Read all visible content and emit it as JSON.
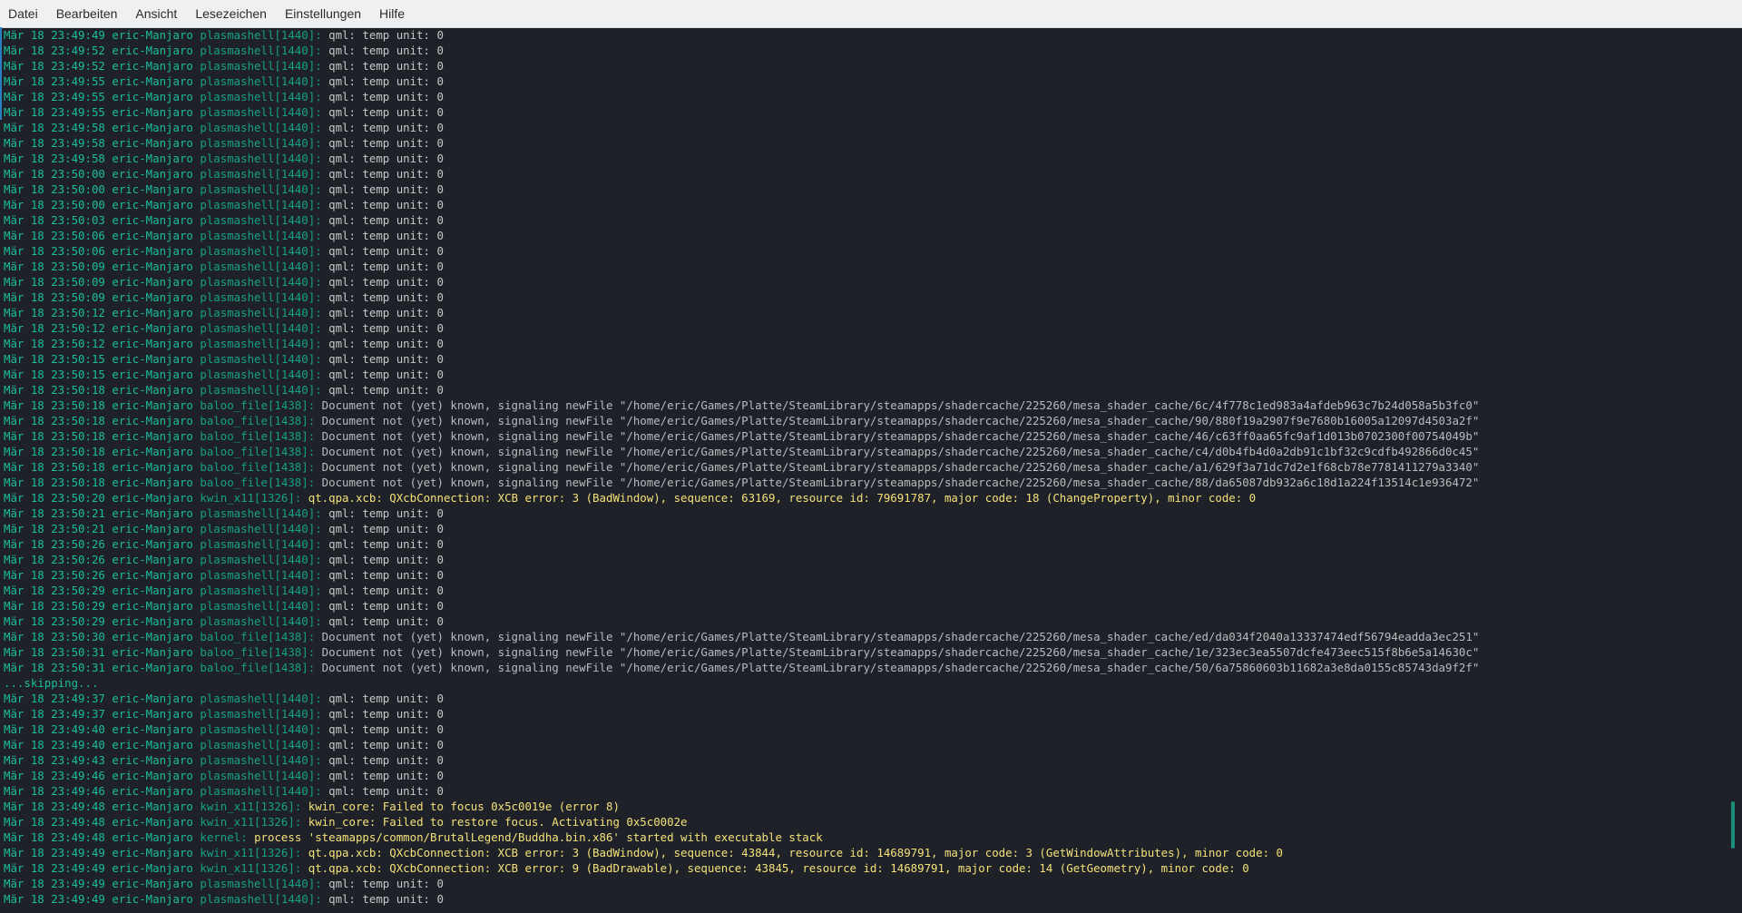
{
  "menubar": {
    "items": [
      "Datei",
      "Bearbeiten",
      "Ansicht",
      "Lesezeichen",
      "Einstellungen",
      "Hilfe"
    ]
  },
  "colors": {
    "background": "#1e2228",
    "timestamp": "#1abc9c",
    "warning": "#f4e07a",
    "message": "#c6c7c6"
  },
  "log": {
    "lines": [
      {
        "ts": "Mär 18 23:49:49",
        "host": "eric-Manjaro",
        "proc": "plasmashell[1440]:",
        "msg": "qml: temp unit: 0",
        "level": "normal",
        "sel": true
      },
      {
        "ts": "Mär 18 23:49:52",
        "host": "eric-Manjaro",
        "proc": "plasmashell[1440]:",
        "msg": "qml: temp unit: 0",
        "level": "normal",
        "sel": true
      },
      {
        "ts": "Mär 18 23:49:52",
        "host": "eric-Manjaro",
        "proc": "plasmashell[1440]:",
        "msg": "qml: temp unit: 0",
        "level": "normal",
        "sel": true
      },
      {
        "ts": "Mär 18 23:49:55",
        "host": "eric-Manjaro",
        "proc": "plasmashell[1440]:",
        "msg": "qml: temp unit: 0",
        "level": "normal",
        "sel": true
      },
      {
        "ts": "Mär 18 23:49:55",
        "host": "eric-Manjaro",
        "proc": "plasmashell[1440]:",
        "msg": "qml: temp unit: 0",
        "level": "normal",
        "sel": true
      },
      {
        "ts": "Mär 18 23:49:55",
        "host": "eric-Manjaro",
        "proc": "plasmashell[1440]:",
        "msg": "qml: temp unit: 0",
        "level": "normal",
        "sel": true
      },
      {
        "ts": "Mär 18 23:49:58",
        "host": "eric-Manjaro",
        "proc": "plasmashell[1440]:",
        "msg": "qml: temp unit: 0",
        "level": "normal"
      },
      {
        "ts": "Mär 18 23:49:58",
        "host": "eric-Manjaro",
        "proc": "plasmashell[1440]:",
        "msg": "qml: temp unit: 0",
        "level": "normal"
      },
      {
        "ts": "Mär 18 23:49:58",
        "host": "eric-Manjaro",
        "proc": "plasmashell[1440]:",
        "msg": "qml: temp unit: 0",
        "level": "normal"
      },
      {
        "ts": "Mär 18 23:50:00",
        "host": "eric-Manjaro",
        "proc": "plasmashell[1440]:",
        "msg": "qml: temp unit: 0",
        "level": "normal"
      },
      {
        "ts": "Mär 18 23:50:00",
        "host": "eric-Manjaro",
        "proc": "plasmashell[1440]:",
        "msg": "qml: temp unit: 0",
        "level": "normal"
      },
      {
        "ts": "Mär 18 23:50:00",
        "host": "eric-Manjaro",
        "proc": "plasmashell[1440]:",
        "msg": "qml: temp unit: 0",
        "level": "normal"
      },
      {
        "ts": "Mär 18 23:50:03",
        "host": "eric-Manjaro",
        "proc": "plasmashell[1440]:",
        "msg": "qml: temp unit: 0",
        "level": "normal"
      },
      {
        "ts": "Mär 18 23:50:06",
        "host": "eric-Manjaro",
        "proc": "plasmashell[1440]:",
        "msg": "qml: temp unit: 0",
        "level": "normal"
      },
      {
        "ts": "Mär 18 23:50:06",
        "host": "eric-Manjaro",
        "proc": "plasmashell[1440]:",
        "msg": "qml: temp unit: 0",
        "level": "normal"
      },
      {
        "ts": "Mär 18 23:50:09",
        "host": "eric-Manjaro",
        "proc": "plasmashell[1440]:",
        "msg": "qml: temp unit: 0",
        "level": "normal"
      },
      {
        "ts": "Mär 18 23:50:09",
        "host": "eric-Manjaro",
        "proc": "plasmashell[1440]:",
        "msg": "qml: temp unit: 0",
        "level": "normal"
      },
      {
        "ts": "Mär 18 23:50:09",
        "host": "eric-Manjaro",
        "proc": "plasmashell[1440]:",
        "msg": "qml: temp unit: 0",
        "level": "normal"
      },
      {
        "ts": "Mär 18 23:50:12",
        "host": "eric-Manjaro",
        "proc": "plasmashell[1440]:",
        "msg": "qml: temp unit: 0",
        "level": "normal"
      },
      {
        "ts": "Mär 18 23:50:12",
        "host": "eric-Manjaro",
        "proc": "plasmashell[1440]:",
        "msg": "qml: temp unit: 0",
        "level": "normal"
      },
      {
        "ts": "Mär 18 23:50:12",
        "host": "eric-Manjaro",
        "proc": "plasmashell[1440]:",
        "msg": "qml: temp unit: 0",
        "level": "normal"
      },
      {
        "ts": "Mär 18 23:50:15",
        "host": "eric-Manjaro",
        "proc": "plasmashell[1440]:",
        "msg": "qml: temp unit: 0",
        "level": "normal"
      },
      {
        "ts": "Mär 18 23:50:15",
        "host": "eric-Manjaro",
        "proc": "plasmashell[1440]:",
        "msg": "qml: temp unit: 0",
        "level": "normal"
      },
      {
        "ts": "Mär 18 23:50:18",
        "host": "eric-Manjaro",
        "proc": "plasmashell[1440]:",
        "msg": "qml: temp unit: 0",
        "level": "normal"
      },
      {
        "ts": "Mär 18 23:50:18",
        "host": "eric-Manjaro",
        "proc": "baloo_file[1438]:",
        "msg": "Document not (yet) known, signaling newFile \"/home/eric/Games/Platte/SteamLibrary/steamapps/shadercache/225260/mesa_shader_cache/6c/4f778c1ed983a4afdeb963c7b24d058a5b3fc0\"",
        "level": "note"
      },
      {
        "ts": "Mär 18 23:50:18",
        "host": "eric-Manjaro",
        "proc": "baloo_file[1438]:",
        "msg": "Document not (yet) known, signaling newFile \"/home/eric/Games/Platte/SteamLibrary/steamapps/shadercache/225260/mesa_shader_cache/90/880f19a2907f9e7680b16005a12097d4503a2f\"",
        "level": "note"
      },
      {
        "ts": "Mär 18 23:50:18",
        "host": "eric-Manjaro",
        "proc": "baloo_file[1438]:",
        "msg": "Document not (yet) known, signaling newFile \"/home/eric/Games/Platte/SteamLibrary/steamapps/shadercache/225260/mesa_shader_cache/46/c63ff0aa65fc9af1d013b0702300f00754049b\"",
        "level": "note"
      },
      {
        "ts": "Mär 18 23:50:18",
        "host": "eric-Manjaro",
        "proc": "baloo_file[1438]:",
        "msg": "Document not (yet) known, signaling newFile \"/home/eric/Games/Platte/SteamLibrary/steamapps/shadercache/225260/mesa_shader_cache/c4/d0b4fb4d0a2db91c1bf32c9cdfb492866d0c45\"",
        "level": "note"
      },
      {
        "ts": "Mär 18 23:50:18",
        "host": "eric-Manjaro",
        "proc": "baloo_file[1438]:",
        "msg": "Document not (yet) known, signaling newFile \"/home/eric/Games/Platte/SteamLibrary/steamapps/shadercache/225260/mesa_shader_cache/a1/629f3a71dc7d2e1f68cb78e7781411279a3340\"",
        "level": "note"
      },
      {
        "ts": "Mär 18 23:50:18",
        "host": "eric-Manjaro",
        "proc": "baloo_file[1438]:",
        "msg": "Document not (yet) known, signaling newFile \"/home/eric/Games/Platte/SteamLibrary/steamapps/shadercache/225260/mesa_shader_cache/88/da65087db932a6c18d1a224f13514c1e936472\"",
        "level": "note"
      },
      {
        "ts": "Mär 18 23:50:20",
        "host": "eric-Manjaro",
        "proc": "kwin_x11[1326]:",
        "msg": "qt.qpa.xcb: QXcbConnection: XCB error: 3 (BadWindow), sequence: 63169, resource id: 79691787, major code: 18 (ChangeProperty), minor code: 0",
        "level": "warn"
      },
      {
        "ts": "Mär 18 23:50:21",
        "host": "eric-Manjaro",
        "proc": "plasmashell[1440]:",
        "msg": "qml: temp unit: 0",
        "level": "normal"
      },
      {
        "ts": "Mär 18 23:50:21",
        "host": "eric-Manjaro",
        "proc": "plasmashell[1440]:",
        "msg": "qml: temp unit: 0",
        "level": "normal"
      },
      {
        "ts": "Mär 18 23:50:26",
        "host": "eric-Manjaro",
        "proc": "plasmashell[1440]:",
        "msg": "qml: temp unit: 0",
        "level": "normal"
      },
      {
        "ts": "Mär 18 23:50:26",
        "host": "eric-Manjaro",
        "proc": "plasmashell[1440]:",
        "msg": "qml: temp unit: 0",
        "level": "normal"
      },
      {
        "ts": "Mär 18 23:50:26",
        "host": "eric-Manjaro",
        "proc": "plasmashell[1440]:",
        "msg": "qml: temp unit: 0",
        "level": "normal"
      },
      {
        "ts": "Mär 18 23:50:29",
        "host": "eric-Manjaro",
        "proc": "plasmashell[1440]:",
        "msg": "qml: temp unit: 0",
        "level": "normal"
      },
      {
        "ts": "Mär 18 23:50:29",
        "host": "eric-Manjaro",
        "proc": "plasmashell[1440]:",
        "msg": "qml: temp unit: 0",
        "level": "normal"
      },
      {
        "ts": "Mär 18 23:50:29",
        "host": "eric-Manjaro",
        "proc": "plasmashell[1440]:",
        "msg": "qml: temp unit: 0",
        "level": "normal"
      },
      {
        "ts": "Mär 18 23:50:30",
        "host": "eric-Manjaro",
        "proc": "baloo_file[1438]:",
        "msg": "Document not (yet) known, signaling newFile \"/home/eric/Games/Platte/SteamLibrary/steamapps/shadercache/225260/mesa_shader_cache/ed/da034f2040a13337474edf56794eadda3ec251\"",
        "level": "note"
      },
      {
        "ts": "Mär 18 23:50:31",
        "host": "eric-Manjaro",
        "proc": "baloo_file[1438]:",
        "msg": "Document not (yet) known, signaling newFile \"/home/eric/Games/Platte/SteamLibrary/steamapps/shadercache/225260/mesa_shader_cache/1e/323ec3ea5507dcfe473eec515f8b6e5a14630c\"",
        "level": "note"
      },
      {
        "ts": "Mär 18 23:50:31",
        "host": "eric-Manjaro",
        "proc": "baloo_file[1438]:",
        "msg": "Document not (yet) known, signaling newFile \"/home/eric/Games/Platte/SteamLibrary/steamapps/shadercache/225260/mesa_shader_cache/50/6a75860603b11682a3e8da0155c85743da9f2f\"",
        "level": "note"
      },
      {
        "skip": "...skipping..."
      },
      {
        "ts": "Mär 18 23:49:37",
        "host": "eric-Manjaro",
        "proc": "plasmashell[1440]:",
        "msg": "qml: temp unit: 0",
        "level": "normal"
      },
      {
        "ts": "Mär 18 23:49:37",
        "host": "eric-Manjaro",
        "proc": "plasmashell[1440]:",
        "msg": "qml: temp unit: 0",
        "level": "normal"
      },
      {
        "ts": "Mär 18 23:49:40",
        "host": "eric-Manjaro",
        "proc": "plasmashell[1440]:",
        "msg": "qml: temp unit: 0",
        "level": "normal"
      },
      {
        "ts": "Mär 18 23:49:40",
        "host": "eric-Manjaro",
        "proc": "plasmashell[1440]:",
        "msg": "qml: temp unit: 0",
        "level": "normal"
      },
      {
        "ts": "Mär 18 23:49:43",
        "host": "eric-Manjaro",
        "proc": "plasmashell[1440]:",
        "msg": "qml: temp unit: 0",
        "level": "normal"
      },
      {
        "ts": "Mär 18 23:49:46",
        "host": "eric-Manjaro",
        "proc": "plasmashell[1440]:",
        "msg": "qml: temp unit: 0",
        "level": "normal"
      },
      {
        "ts": "Mär 18 23:49:46",
        "host": "eric-Manjaro",
        "proc": "plasmashell[1440]:",
        "msg": "qml: temp unit: 0",
        "level": "normal"
      },
      {
        "ts": "Mär 18 23:49:48",
        "host": "eric-Manjaro",
        "proc": "kwin_x11[1326]:",
        "msg": "kwin_core: Failed to focus 0x5c0019e (error 8)",
        "level": "warn"
      },
      {
        "ts": "Mär 18 23:49:48",
        "host": "eric-Manjaro",
        "proc": "kwin_x11[1326]:",
        "msg": "kwin_core: Failed to restore focus. Activating 0x5c0002e",
        "level": "warn"
      },
      {
        "ts": "Mär 18 23:49:48",
        "host": "eric-Manjaro",
        "proc": "kernel:",
        "msg": "process 'steamapps/common/BrutalLegend/Buddha.bin.x86' started with executable stack",
        "level": "warn"
      },
      {
        "ts": "Mär 18 23:49:49",
        "host": "eric-Manjaro",
        "proc": "kwin_x11[1326]:",
        "msg": "qt.qpa.xcb: QXcbConnection: XCB error: 3 (BadWindow), sequence: 43844, resource id: 14689791, major code: 3 (GetWindowAttributes), minor code: 0",
        "level": "warn"
      },
      {
        "ts": "Mär 18 23:49:49",
        "host": "eric-Manjaro",
        "proc": "kwin_x11[1326]:",
        "msg": "qt.qpa.xcb: QXcbConnection: XCB error: 9 (BadDrawable), sequence: 43845, resource id: 14689791, major code: 14 (GetGeometry), minor code: 0",
        "level": "warn"
      },
      {
        "ts": "Mär 18 23:49:49",
        "host": "eric-Manjaro",
        "proc": "plasmashell[1440]:",
        "msg": "qml: temp unit: 0",
        "level": "normal"
      },
      {
        "ts": "Mär 18 23:49:49",
        "host": "eric-Manjaro",
        "proc": "plasmashell[1440]:",
        "msg": "qml: temp unit: 0",
        "level": "normal"
      }
    ]
  }
}
